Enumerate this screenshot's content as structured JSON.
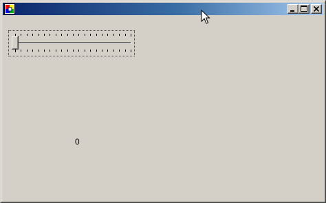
{
  "window": {
    "title": ""
  },
  "icons": {
    "app": "app-icon",
    "minimize": "minimize-icon",
    "maximize": "maximize-icon",
    "close": "close-icon",
    "cursor": "mouse-pointer-icon"
  },
  "colors": {
    "face": "#d4d0c8",
    "title_start": "#0a246a",
    "title_end": "#a6caf0"
  },
  "trackbar": {
    "minimum": 0,
    "maximum": 20,
    "value": 0,
    "tick_count": 21
  },
  "value_label": {
    "text": "0"
  }
}
